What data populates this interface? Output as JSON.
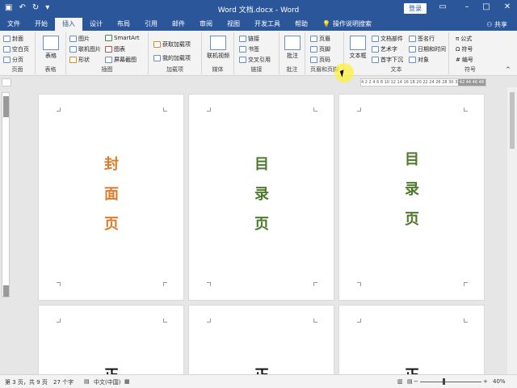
{
  "window": {
    "title": "Word  文档.docx  -  Word",
    "login_label": "登录",
    "share_label": "共享"
  },
  "tabs": [
    "文件",
    "开始",
    "插入",
    "设计",
    "布局",
    "引用",
    "邮件",
    "审阅",
    "视图",
    "开发工具",
    "帮助"
  ],
  "search_label": "操作说明搜索",
  "ribbon": {
    "pages": {
      "label": "页面",
      "items": [
        "封面",
        "空白页",
        "分页"
      ]
    },
    "tables": {
      "label": "表格",
      "button": "表格"
    },
    "illustrations": {
      "label": "插图",
      "items": [
        "图片",
        "联机图片",
        "形状",
        "SmartArt",
        "图表",
        "屏幕截图"
      ]
    },
    "addins": {
      "label": "加载项",
      "items": [
        "获取加载项",
        "我的加载项"
      ]
    },
    "media": {
      "label": "媒体",
      "button": "联机视频"
    },
    "links": {
      "label": "链接",
      "items": [
        "链接",
        "书签",
        "交叉引用"
      ]
    },
    "comments": {
      "label": "批注",
      "button": "批注"
    },
    "header_footer": {
      "label": "页眉和页脚",
      "items": [
        "页眉",
        "页脚",
        "页码"
      ]
    },
    "text": {
      "label": "文本",
      "textbox": "文本框",
      "items": [
        "文档部件",
        "艺术字",
        "首字下沉",
        "签名行",
        "日期和时间",
        "对象"
      ]
    },
    "symbols": {
      "label": "符号",
      "items": [
        "公式",
        "符号",
        "编号"
      ]
    }
  },
  "ruler": {
    "ticks": "4  2     2  4  6  8 10 12 14 16 18 20 22 24 26 28 30 32 34 36 38",
    "end": "42 44 46 48"
  },
  "pages": [
    {
      "chars": [
        "封",
        "面",
        "页"
      ],
      "color": "#e07b2a"
    },
    {
      "chars": [
        "目",
        "录",
        "页"
      ],
      "color": "#4e7a2e"
    },
    {
      "chars": [
        "目",
        "录",
        "页"
      ],
      "color": "#4e7a2e"
    }
  ],
  "body_pages": [
    {
      "char": "正"
    },
    {
      "char": "正"
    },
    {
      "char": "正"
    }
  ],
  "status": {
    "page": "第 3 页，共 9 页",
    "words": "27 个字",
    "lang": "中文(中国)",
    "zoom": "40%"
  }
}
